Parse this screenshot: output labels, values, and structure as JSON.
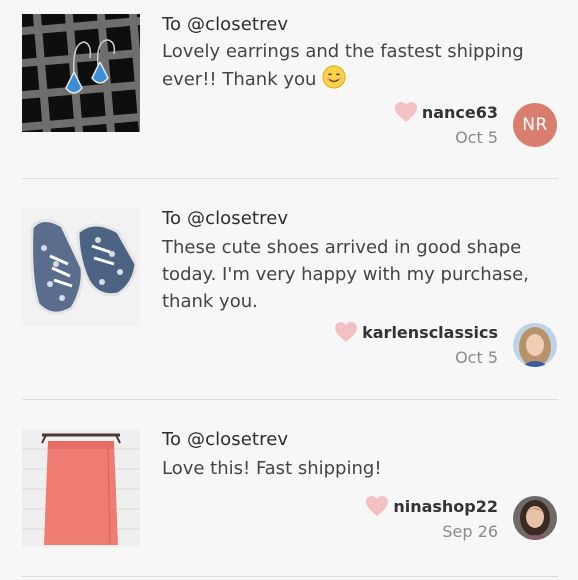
{
  "reviews": [
    {
      "recipient": "To @closetrev",
      "message": "Lovely earrings and the fastest shipping ever!! Thank you",
      "emoji": "smiling-face",
      "username": "nance63",
      "date": "Oct 5",
      "avatar_initials": "NR",
      "avatar_color": "#d97d6f",
      "image": "earrings-photo"
    },
    {
      "recipient": "To @closetrev",
      "message": "These cute shoes arrived in good shape today. I'm very happy with my purchase, thank you.",
      "username": "karlensclassics",
      "date": "Oct 5",
      "image": "sneakers-photo"
    },
    {
      "recipient": "To @closetrev",
      "message": "Love this! Fast shipping!",
      "username": "ninashop22",
      "date": "Sep 26",
      "image": "skirt-photo"
    }
  ],
  "colors": {
    "heart": "#f3c1c3",
    "divider": "#dcdcdc",
    "background": "#f7f7f7"
  }
}
